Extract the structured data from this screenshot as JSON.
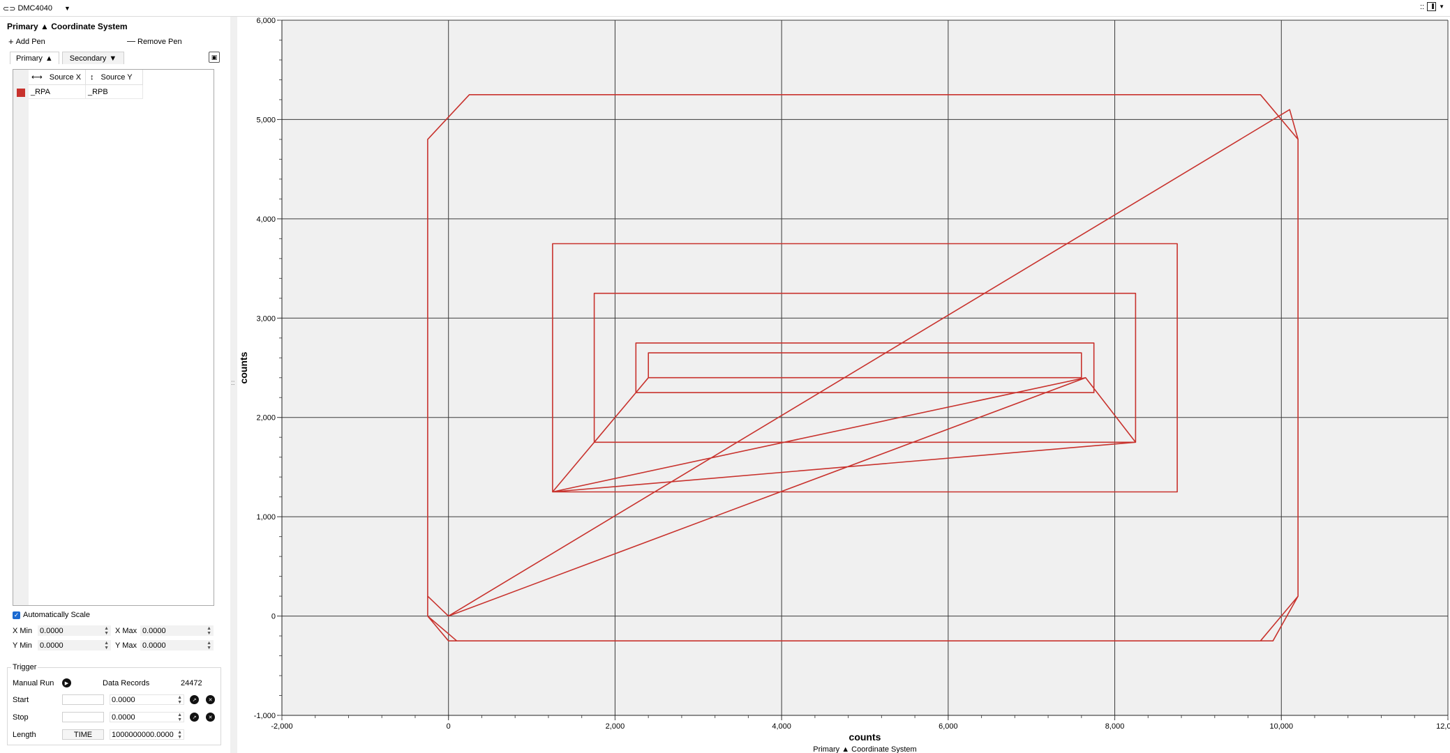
{
  "topbar": {
    "connection_label": "DMC4040",
    "layout_dots": "::"
  },
  "panel": {
    "title": "Primary ▲ Coordinate System",
    "add_pen": "Add Pen",
    "remove_pen": "Remove Pen",
    "tabs": [
      {
        "label": "Primary",
        "marker": "▲"
      },
      {
        "label": "Secondary",
        "marker": "▼"
      }
    ],
    "columns": {
      "source_x": "Source X",
      "source_y": "Source Y"
    },
    "pens": [
      {
        "color": "#c8322d",
        "source_x": "_RPA",
        "source_y": "_RPB"
      }
    ],
    "auto_scale_label": "Automatically Scale",
    "auto_scale_checked": true,
    "x_min_label": "X Min",
    "x_min": "0.0000",
    "x_max_label": "X Max",
    "x_max": "0.0000",
    "y_min_label": "Y Min",
    "y_min": "0.0000",
    "y_max_label": "Y Max",
    "y_max": "0.0000"
  },
  "trigger": {
    "title": "Trigger",
    "manual_run": "Manual Run",
    "data_records_label": "Data Records",
    "data_records": "24472",
    "start_label": "Start",
    "start_value": "0.0000",
    "stop_label": "Stop",
    "stop_value": "0.0000",
    "length_label": "Length",
    "length_mode": "TIME",
    "length_value": "1000000000.0000"
  },
  "chart_data": {
    "type": "line",
    "xlabel": "counts",
    "ylabel": "counts",
    "caption": "Primary ▲ Coordinate System",
    "xlim": [
      -2000,
      12000
    ],
    "ylim": [
      -1000,
      6000
    ],
    "x_ticks": [
      -2000,
      0,
      2000,
      4000,
      6000,
      8000,
      10000,
      12000
    ],
    "x_tick_labels": [
      "-2,000",
      "0",
      "2,000",
      "4,000",
      "6,000",
      "8,000",
      "10,000",
      "12,000"
    ],
    "y_ticks": [
      -1000,
      0,
      1000,
      2000,
      3000,
      4000,
      5000,
      6000
    ],
    "y_tick_labels": [
      "-1,000",
      "0",
      "1,000",
      "2,000",
      "3,000",
      "4,000",
      "5,000",
      "6,000"
    ],
    "grid": true,
    "color": "#c8322d",
    "series": [
      {
        "x": [
          0,
          10100,
          10100,
          10200,
          10200,
          9750,
          0,
          -250,
          -250,
          250,
          9750,
          10200,
          10200,
          9900,
          100,
          -250,
          -250,
          0,
          7650,
          1250,
          8250,
          7650,
          1250,
          7650,
          1250,
          1250,
          8750,
          8750,
          1250,
          1750,
          1750,
          8250,
          8250,
          1750,
          2250,
          2250,
          7750,
          7750,
          2250,
          2400,
          2400,
          7600,
          7600,
          2400
        ],
        "y": [
          0,
          5100,
          5100,
          4800,
          200,
          -250,
          -250,
          0,
          4800,
          5250,
          5250,
          4800,
          200,
          -250,
          -250,
          0,
          200,
          0,
          2400,
          1250,
          1750,
          2400,
          1250,
          2400,
          1250,
          3750,
          3750,
          1250,
          1250,
          1750,
          3250,
          3250,
          1750,
          1750,
          2250,
          2750,
          2750,
          2250,
          2250,
          2400,
          2650,
          2650,
          2400,
          2400
        ]
      }
    ]
  }
}
